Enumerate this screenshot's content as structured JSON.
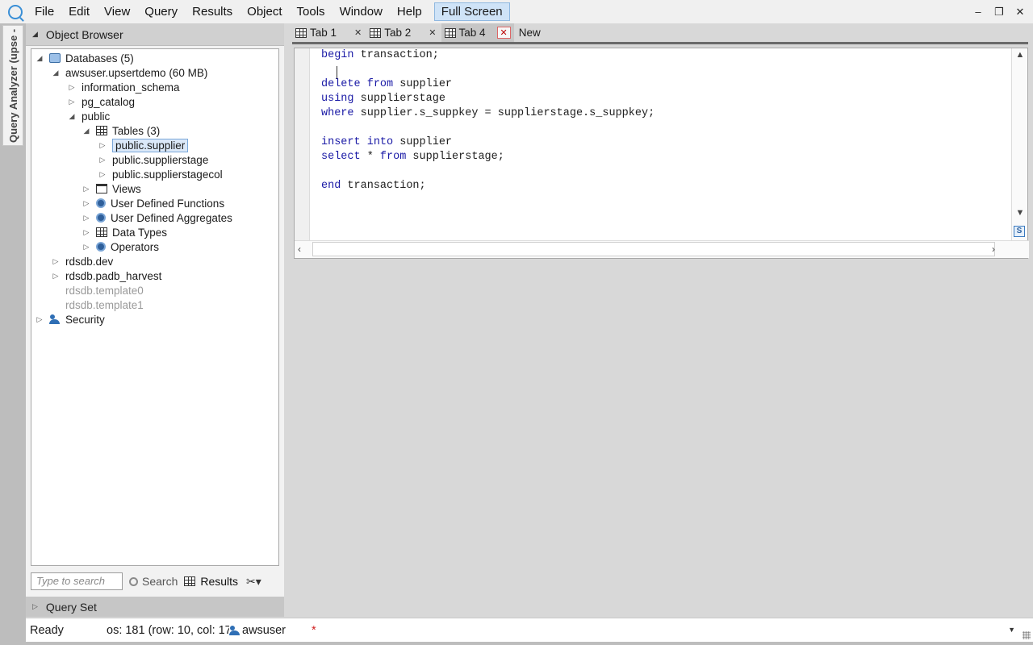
{
  "menu": {
    "items": [
      "File",
      "Edit",
      "View",
      "Query",
      "Results",
      "Object",
      "Tools",
      "Window",
      "Help"
    ],
    "full_screen": "Full Screen"
  },
  "window_controls": {
    "minimize": "–",
    "restore": "❐",
    "close": "✕"
  },
  "rail": {
    "label": "Query Analyzer (upse -"
  },
  "object_browser": {
    "title": "Object Browser",
    "tree": {
      "databases": "Databases (5)",
      "db_upsertdemo": "awsuser.upsertdemo (60 MB)",
      "information_schema": "information_schema",
      "pg_catalog": "pg_catalog",
      "public": "public",
      "tables": "Tables (3)",
      "table_supplier": "public.supplier",
      "table_supplierstage": "public.supplierstage",
      "table_supplierstagecol": "public.supplierstagecol",
      "views": "Views",
      "udf": "User Defined Functions",
      "uda": "User Defined Aggregates",
      "data_types": "Data Types",
      "operators": "Operators",
      "db_dev": "rdsdb.dev",
      "db_padb_harvest": "rdsdb.padb_harvest",
      "db_template0": "rdsdb.template0",
      "db_template1": "rdsdb.template1",
      "security": "Security"
    },
    "search_placeholder": "Type to search",
    "search_label": "Search",
    "results_label": "Results"
  },
  "query_set": {
    "title": "Query Set"
  },
  "tabs": [
    {
      "label": "Tab 1",
      "active": false
    },
    {
      "label": "Tab 2",
      "active": false
    },
    {
      "label": "Tab 4",
      "active": true
    }
  ],
  "tab_new": "New",
  "editor": {
    "lines": [
      {
        "kw1": "begin",
        "rest": " transaction;"
      },
      {
        "kw1": "delete",
        "mid": " ",
        "kw2": "from",
        "rest": " supplier"
      },
      {
        "kw1": "using",
        "rest": " supplierstage"
      },
      {
        "kw1": "where",
        "rest": " supplier.s_suppkey = supplierstage.s_suppkey;"
      },
      {
        "kw1": "insert",
        "mid": " ",
        "kw2": "into",
        "rest": " supplier"
      },
      {
        "kw1": "select",
        "mid": " * ",
        "kw2": "from",
        "rest": " supplierstage;"
      },
      {
        "kw1": "end",
        "rest": " transaction;"
      }
    ]
  },
  "status": {
    "ready": "Ready",
    "position": "os: 181 (row: 10, col: 17",
    "user": "awsuser",
    "modified": "*"
  },
  "colors": {
    "keyword": "#1a1aa6",
    "accent": "#3a8fd6",
    "modified": "#d02020"
  }
}
